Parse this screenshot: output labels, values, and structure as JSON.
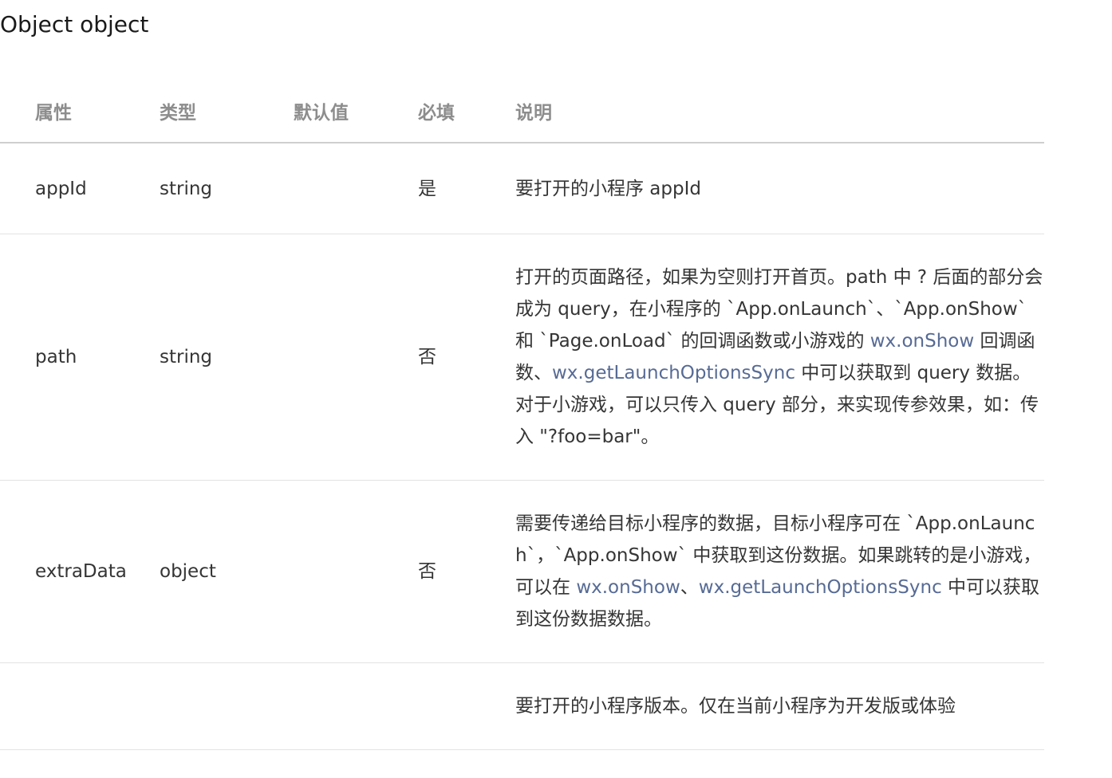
{
  "page": {
    "title": "Object object"
  },
  "table": {
    "headers": {
      "name": "属性",
      "type": "类型",
      "default": "默认值",
      "required": "必填",
      "description": "说明"
    },
    "rows": [
      {
        "name": "appId",
        "type": "string",
        "default": "",
        "required": "是",
        "description": {
          "text_1": "要打开的小程序 appId"
        }
      },
      {
        "name": "path",
        "type": "string",
        "default": "",
        "required": "否",
        "description": {
          "text_1": "打开的页面路径，如果为空则打开首页。path 中 ? 后面的部分会成为 query，在小程序的 `App.onLaunch`、`App.onShow` 和 `Page.onLoad` 的回调函数或小游戏的 ",
          "link_1": "wx.onShow",
          "text_2": " 回调函数、",
          "link_2": "wx.getLaunchOptionsSync",
          "text_3": " 中可以获取到 query 数据。对于小游戏，可以只传入 query 部分，来实现传参效果，如：传入 \"?foo=bar\"。"
        }
      },
      {
        "name": "extraData",
        "type": "object",
        "default": "",
        "required": "否",
        "description": {
          "text_1": "需要传递给目标小程序的数据，目标小程序可在 `App.onLaunch`，`App.onShow` 中获取到这份数据。如果跳转的是小游戏，可以在 ",
          "link_1": "wx.onShow",
          "text_2": "、",
          "link_2": "wx.getLaunchOptionsSync",
          "text_3": " 中可以获取到这份数据数据。"
        }
      },
      {
        "name": "",
        "type": "",
        "default": "",
        "required": "",
        "description": {
          "text_1": "要打开的小程序版本。仅在当前小程序为开发版或体验"
        }
      }
    ]
  }
}
